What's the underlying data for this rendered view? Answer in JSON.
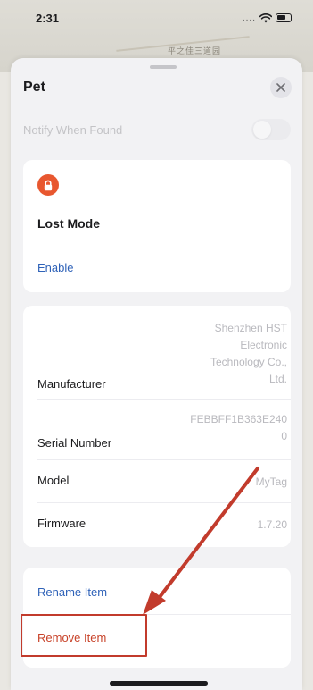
{
  "status_bar": {
    "time": "2:31",
    "signal": "....",
    "wifi_icon": "wifi-icon",
    "battery_icon": "battery-icon"
  },
  "map": {
    "label": "平之佳三道园"
  },
  "sheet": {
    "title": "Pet",
    "close_icon": "close-icon"
  },
  "notify": {
    "label": "Notify When Found",
    "enabled": false
  },
  "lost_mode": {
    "title": "Lost Mode",
    "enable_label": "Enable",
    "icon": "lock-icon",
    "accent_color": "#e8572f"
  },
  "info": {
    "manufacturer": {
      "label": "Manufacturer",
      "value_lines": [
        "Shenzhen HST",
        "Electronic",
        "Technology Co.,",
        "Ltd."
      ]
    },
    "serial_number": {
      "label": "Serial Number",
      "value_lines": [
        "FEBBFF1B363E240",
        "0"
      ]
    },
    "model": {
      "label": "Model",
      "value": "MyTag"
    },
    "firmware": {
      "label": "Firmware",
      "value": "1.7.20"
    }
  },
  "actions": {
    "rename_label": "Rename Item",
    "remove_label": "Remove Item",
    "link_color": "#2f62b8",
    "destructive_color": "#c8432a"
  },
  "annotation": {
    "color": "#c23b2c"
  }
}
